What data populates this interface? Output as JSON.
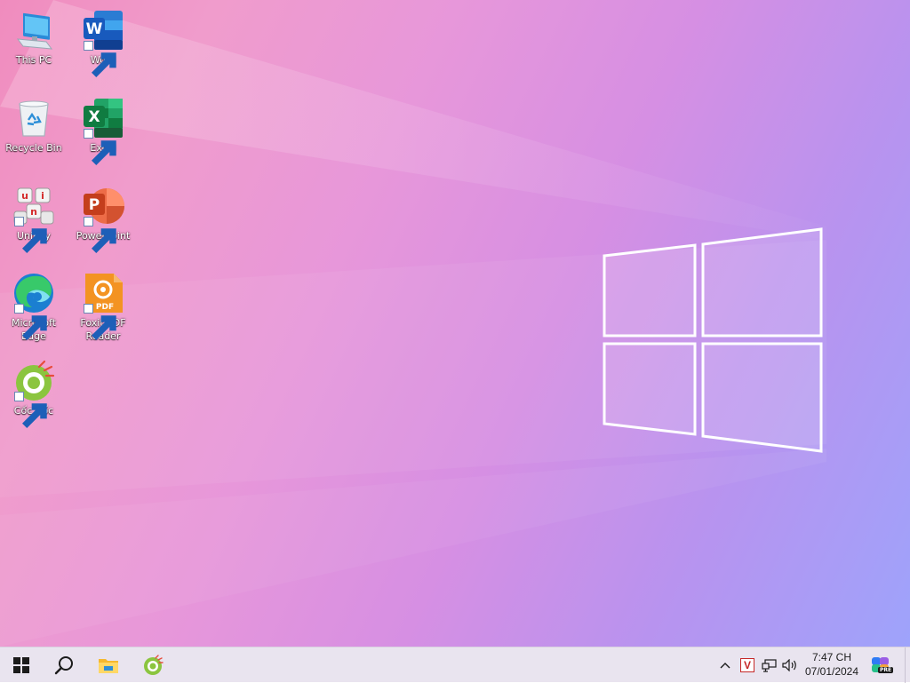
{
  "desktop": {
    "icons": [
      {
        "label": "This PC",
        "icon": "computer-icon"
      },
      {
        "label": "Word",
        "icon": "word-icon"
      },
      {
        "label": "Recycle Bin",
        "icon": "recycle-bin-icon"
      },
      {
        "label": "Excel",
        "icon": "excel-icon"
      },
      {
        "label": "UniKey",
        "icon": "unikey-icon"
      },
      {
        "label": "PowerPoint",
        "icon": "powerpoint-icon"
      },
      {
        "label": "Microsoft Edge",
        "icon": "edge-icon"
      },
      {
        "label": "Foxit PDF Reader",
        "icon": "foxit-pdf-icon"
      },
      {
        "label": "Cốc Cốc",
        "icon": "coccoc-icon"
      }
    ],
    "wallpaper": "windows-logo-wallpaper",
    "colors": {
      "pink": "#f08cbe",
      "violet": "#d68fe3",
      "blue": "#9ea3fb"
    }
  },
  "taskbar": {
    "buttons": [
      {
        "name": "start",
        "icon": "windows-start-icon"
      },
      {
        "name": "search",
        "icon": "search-icon"
      },
      {
        "name": "file-explorer",
        "icon": "folder-icon"
      },
      {
        "name": "coccoc",
        "icon": "coccoc-icon"
      }
    ],
    "tray": {
      "chevron": "chevron-up-icon",
      "ime": "V",
      "network": "network-icon",
      "volume": "volume-icon",
      "copilot": "copilot-icon",
      "copilot_badge": "PRE"
    },
    "clock": {
      "time": "7:47 CH",
      "date": "07/01/2024"
    }
  }
}
